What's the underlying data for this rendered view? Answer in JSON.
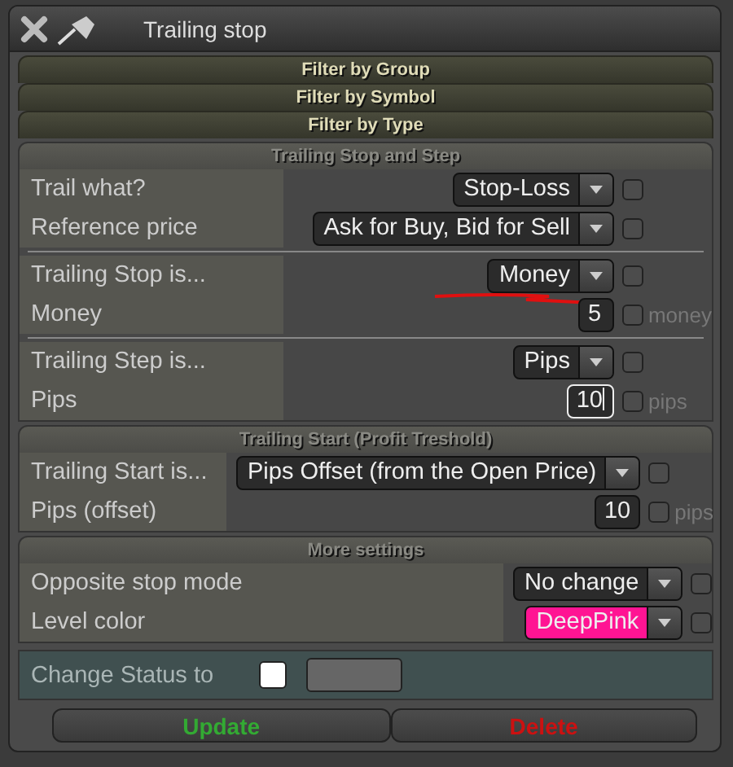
{
  "window": {
    "title": "Trailing stop"
  },
  "filters": [
    {
      "label": "Filter by Group"
    },
    {
      "label": "Filter by Symbol"
    },
    {
      "label": "Filter by Type"
    }
  ],
  "sections": [
    {
      "title": "Trailing Stop and Step",
      "groups": [
        {
          "rows": [
            {
              "kind": "dropdown",
              "label": "Trail what?",
              "value": "Stop-Loss",
              "checked": false
            },
            {
              "kind": "dropdown",
              "label": "Reference price",
              "value": "Ask for Buy, Bid for Sell",
              "checked": false
            }
          ]
        },
        {
          "rows": [
            {
              "kind": "dropdown",
              "label": "Trailing Stop is...",
              "value": "Money",
              "checked": false,
              "annotated": true
            },
            {
              "kind": "number",
              "label": "Money",
              "value": "5",
              "checked": false,
              "unit": "money",
              "focused": false
            }
          ]
        },
        {
          "rows": [
            {
              "kind": "dropdown",
              "label": "Trailing Step is...",
              "value": "Pips",
              "checked": false
            },
            {
              "kind": "number",
              "label": "Pips",
              "value": "10",
              "checked": false,
              "unit": "pips",
              "focused": true
            }
          ]
        }
      ]
    },
    {
      "title": "Trailing Start (Profit Treshold)",
      "groups": [
        {
          "rows": [
            {
              "kind": "dropdown",
              "label": "Trailing Start is...",
              "value": "Pips Offset (from the Open Price)",
              "checked": false
            },
            {
              "kind": "number",
              "label": "Pips (offset)",
              "value": "10",
              "checked": false,
              "unit": "pips",
              "focused": false
            }
          ]
        }
      ]
    },
    {
      "title": "More settings",
      "groups": [
        {
          "rows": [
            {
              "kind": "dropdown",
              "label": "Opposite stop mode",
              "value": "No change",
              "checked": false
            },
            {
              "kind": "dropdown",
              "label": "Level color",
              "value": "DeepPink",
              "checked": false,
              "color": "#ff1493"
            }
          ]
        }
      ]
    }
  ],
  "status": {
    "label": "Change Status to",
    "checked": false
  },
  "buttons": [
    {
      "label": "Update",
      "color": "#33aa33"
    },
    {
      "label": "Delete",
      "color": "#cc1111"
    }
  ]
}
